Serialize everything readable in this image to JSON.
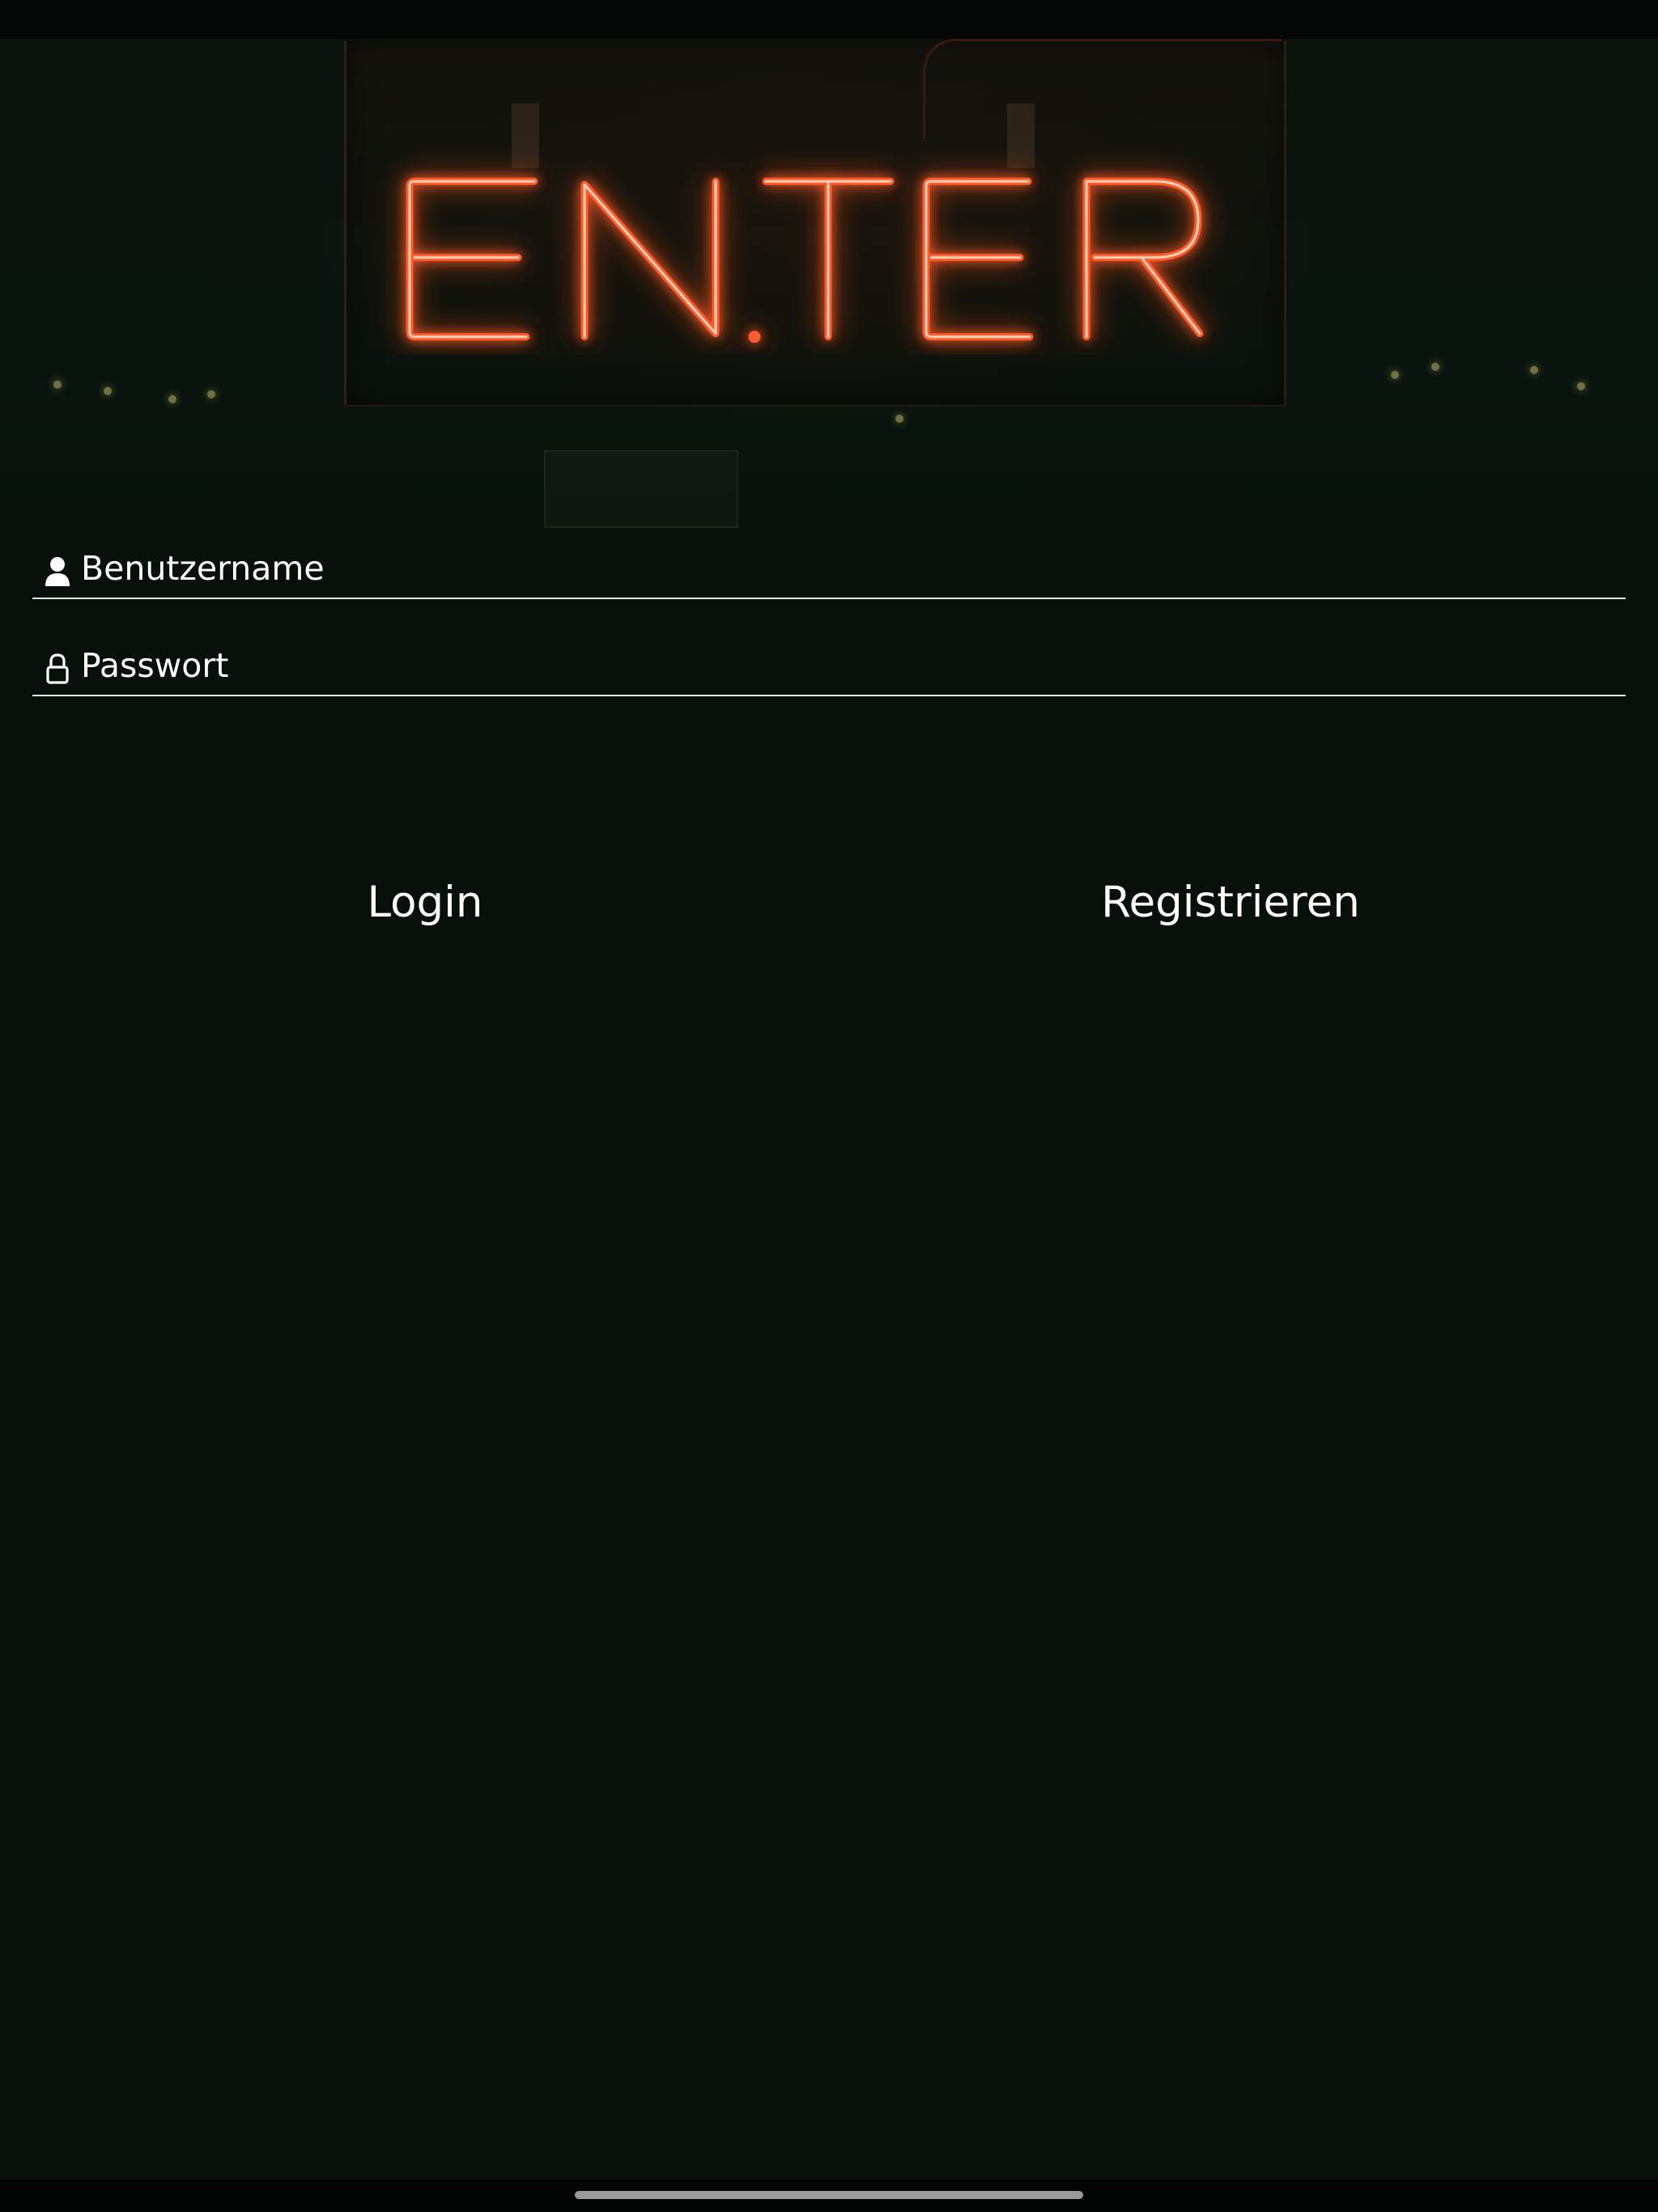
{
  "hero": {
    "sign_text": "ENTER",
    "neon_color": "#ff3a1a"
  },
  "login_form": {
    "username": {
      "icon": "person-icon",
      "placeholder": "Benutzername",
      "value": ""
    },
    "password": {
      "icon": "lock-icon",
      "placeholder": "Passwort",
      "value": ""
    }
  },
  "actions": {
    "login_label": "Login",
    "register_label": "Registrieren"
  },
  "colors": {
    "background": "#071009",
    "text": "#ffffff",
    "field_underline": "#e6e6e6"
  }
}
